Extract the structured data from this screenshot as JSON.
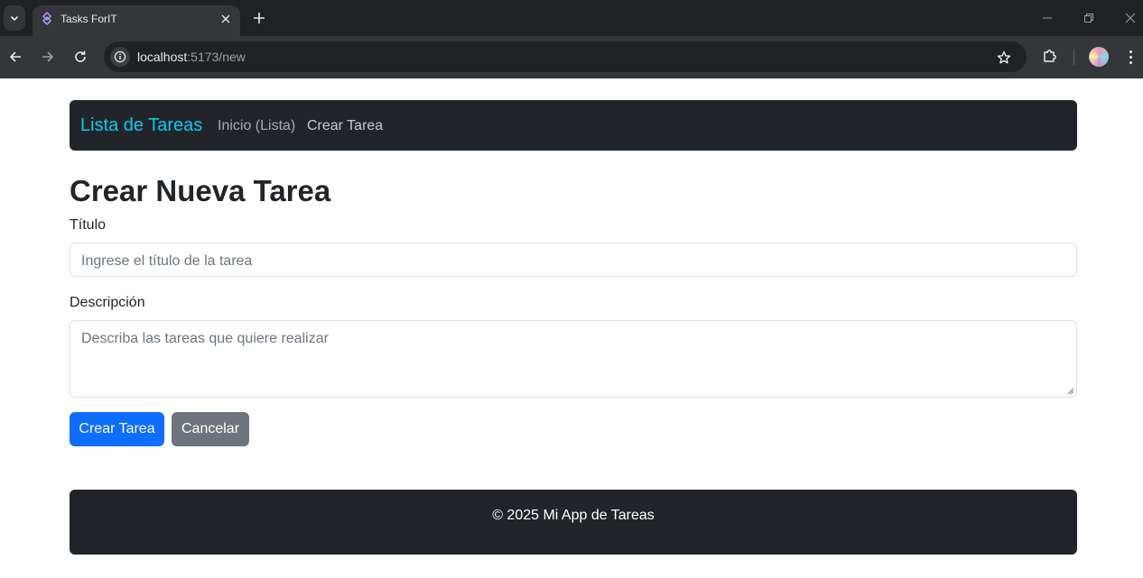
{
  "browser": {
    "tab_title": "Tasks ForIT",
    "url_host": "localhost",
    "url_path": ":5173/new",
    "icons": [
      "tab-search-icon",
      "tab-favicon-icon",
      "close-icon",
      "plus-icon",
      "minimize-icon",
      "restore-icon",
      "close-window-icon",
      "back-icon",
      "forward-icon",
      "reload-icon",
      "info-icon",
      "star-icon",
      "extensions-icon",
      "menu-icon"
    ]
  },
  "navbar": {
    "brand": "Lista de Tareas",
    "links": [
      {
        "label": "Inicio (Lista)"
      },
      {
        "label": "Crear Tarea"
      }
    ],
    "brand_color": "#0dcaf0"
  },
  "form": {
    "heading": "Crear Nueva Tarea",
    "title_label": "Título",
    "title_placeholder": "Ingrese el título de la tarea",
    "title_value": "",
    "description_label": "Descripción",
    "description_placeholder": "Describa las tareas que quiere realizar",
    "description_value": "",
    "submit_label": "Crear Tarea",
    "cancel_label": "Cancelar",
    "primary_color": "#0d6efd",
    "secondary_color": "#6c757d"
  },
  "footer": {
    "text": "© 2025 Mi App de Tareas"
  }
}
